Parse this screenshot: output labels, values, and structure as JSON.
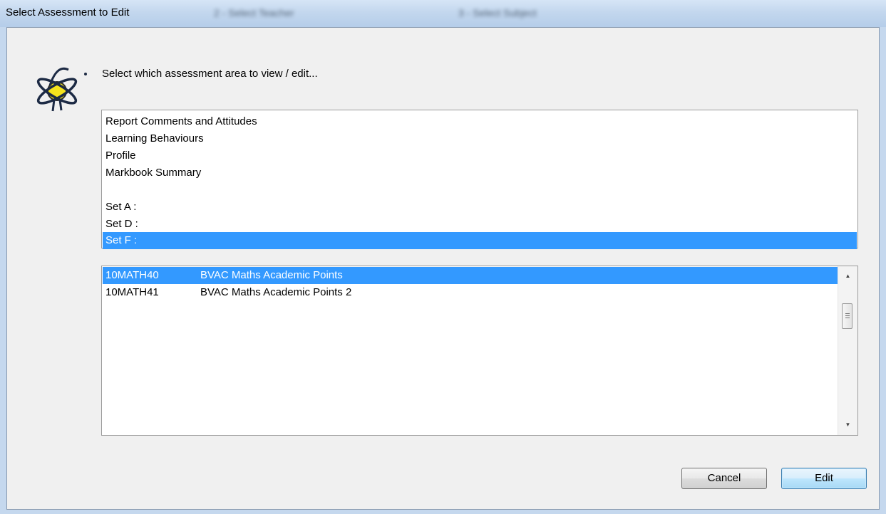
{
  "window": {
    "title": "Select Assessment to Edit",
    "obscured_tabs": [
      "2 - Select Teacher",
      "3 - Select Subject"
    ]
  },
  "prompt": "Select which assessment area to view / edit...",
  "areas": [
    {
      "label": "Report Comments and Attitudes",
      "selected": false
    },
    {
      "label": "Learning Behaviours",
      "selected": false
    },
    {
      "label": "Profile",
      "selected": false
    },
    {
      "label": "Markbook Summary",
      "selected": false
    },
    {
      "label": "",
      "selected": false
    },
    {
      "label": "Set A :",
      "selected": false
    },
    {
      "label": "Set D :",
      "selected": false
    },
    {
      "label": "Set F :",
      "selected": true
    }
  ],
  "assessments": [
    {
      "code": "10MATH40",
      "name": "BVAC Maths Academic Points",
      "selected": true
    },
    {
      "code": "10MATH41",
      "name": "BVAC Maths Academic Points 2",
      "selected": false
    }
  ],
  "buttons": {
    "cancel": "Cancel",
    "edit": "Edit"
  },
  "icons": {
    "logo": "atom-lightbulb-icon",
    "scroll_up": "scroll-up-arrow-icon",
    "scroll_down": "scroll-down-arrow-icon"
  },
  "colors": {
    "selection": "#3399ff",
    "titlebar": "#c3d7ee"
  }
}
